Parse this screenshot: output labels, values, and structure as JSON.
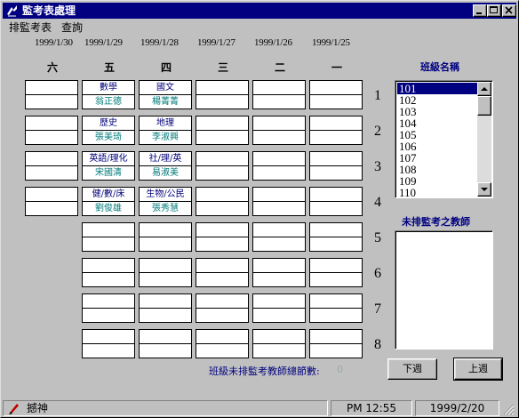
{
  "window": {
    "title": "監考表處理"
  },
  "menu": [
    "排監考表",
    "查詢"
  ],
  "dates": [
    "1999/1/30",
    "1999/1/29",
    "1999/1/28",
    "1999/1/27",
    "1999/1/26",
    "1999/1/25"
  ],
  "days": [
    "六",
    "五",
    "四",
    "三",
    "二",
    "一"
  ],
  "periods": [
    "1",
    "2",
    "3",
    "4",
    "5",
    "6",
    "7",
    "8"
  ],
  "schedule": {
    "p1": {
      "fri": {
        "subject": "數學",
        "teacher": "翁正德"
      },
      "thu": {
        "subject": "國文",
        "teacher": "楊菁菁"
      }
    },
    "p2": {
      "fri": {
        "subject": "歷史",
        "teacher": "張美琦"
      },
      "thu": {
        "subject": "地理",
        "teacher": "李淑興"
      }
    },
    "p3": {
      "fri": {
        "subject": "英語/理化",
        "teacher": "宋國清"
      },
      "thu": {
        "subject": "社/理/英",
        "teacher": "易淑美"
      }
    },
    "p4": {
      "fri": {
        "subject": "健/數/床",
        "teacher": "劉俊雄"
      },
      "thu": {
        "subject": "生物/公民",
        "teacher": "張秀慧"
      }
    }
  },
  "class_list": {
    "label": "班級名稱",
    "items": [
      "101",
      "102",
      "103",
      "104",
      "105",
      "106",
      "107",
      "108",
      "109",
      "110"
    ],
    "selected": "101"
  },
  "unassigned": {
    "label": "未排監考之教師"
  },
  "total": {
    "label": "班級未排監考教師總節數:",
    "value": "0"
  },
  "buttons": {
    "next_week": "下週",
    "prev_week": "上週"
  },
  "status": {
    "user": "撼神",
    "time": "PM 12:55",
    "date": "1999/2/20"
  },
  "colors": {
    "titlebar": "#000080",
    "face": "#c0c0c0",
    "subject": "#00007a",
    "teacher": "#007a7a"
  }
}
